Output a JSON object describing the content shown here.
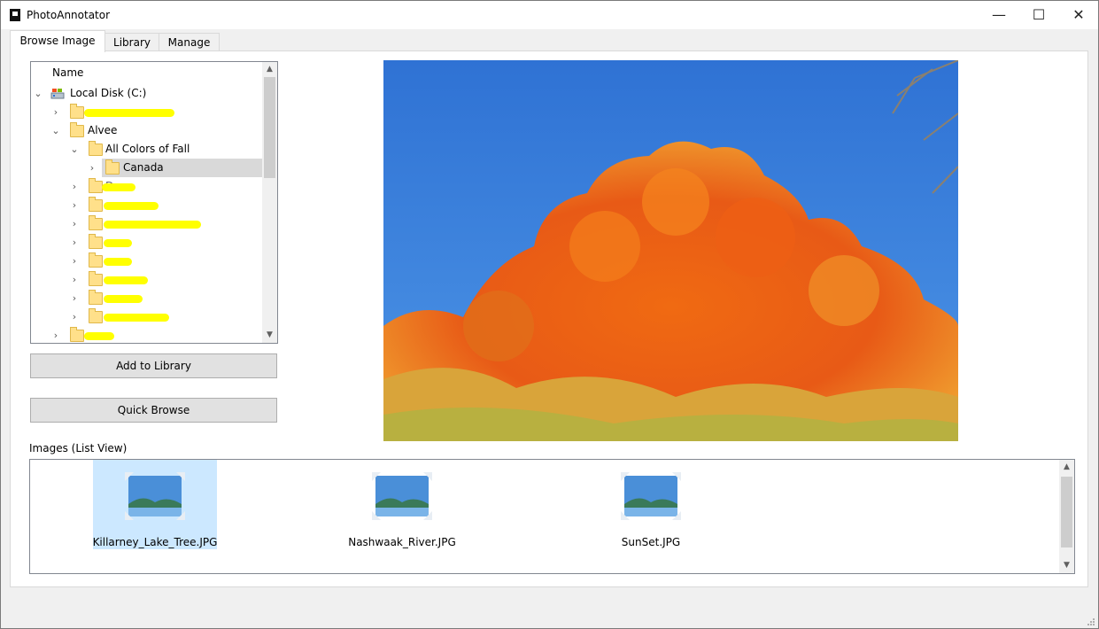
{
  "window": {
    "title": "PhotoAnnotator",
    "minimize": "—",
    "maximize": "☐",
    "close": "✕"
  },
  "tabs": [
    {
      "label": "Browse Image"
    },
    {
      "label": "Library"
    },
    {
      "label": "Manage"
    }
  ],
  "tree": {
    "header": "Name",
    "nodes": [
      {
        "label": "Local Disk (C:)",
        "icon": "drive-icon",
        "expanded": true
      },
      {
        "label": "",
        "icon": "folder-icon",
        "redacted": true
      },
      {
        "label": "Alvee",
        "icon": "folder-icon",
        "expanded": true
      },
      {
        "label": "All Colors of Fall",
        "icon": "folder-icon",
        "expanded": true
      },
      {
        "label": "Canada",
        "icon": "folder-icon",
        "selected": true
      },
      {
        "label": "Docs",
        "icon": "folder-icon",
        "redacted": true
      },
      {
        "label": "",
        "icon": "folder-icon",
        "redacted": true
      },
      {
        "label": "",
        "icon": "folder-icon",
        "redacted": true
      },
      {
        "label": "",
        "icon": "folder-icon",
        "redacted": true
      },
      {
        "label": "",
        "icon": "folder-icon",
        "redacted": true
      },
      {
        "label": "",
        "icon": "folder-icon",
        "redacted": true
      },
      {
        "label": "",
        "icon": "folder-icon",
        "redacted": true
      },
      {
        "label": "",
        "icon": "folder-icon",
        "redacted": true
      },
      {
        "label": "",
        "icon": "folder-icon",
        "redacted": true
      }
    ]
  },
  "buttons": {
    "add_to_library": "Add to Library",
    "quick_browse": "Quick Browse"
  },
  "images_list": {
    "label": "Images (List View)",
    "items": [
      {
        "name": "Killarney_Lake_Tree.JPG",
        "selected": true
      },
      {
        "name": "Nashwaak_River.JPG",
        "selected": false
      },
      {
        "name": "SunSet.JPG",
        "selected": false
      }
    ]
  },
  "colors": {
    "selection": "#cce8ff",
    "sky": "#3a7fd6",
    "foliage": "#e8641c",
    "redaction": "#ffff00"
  }
}
